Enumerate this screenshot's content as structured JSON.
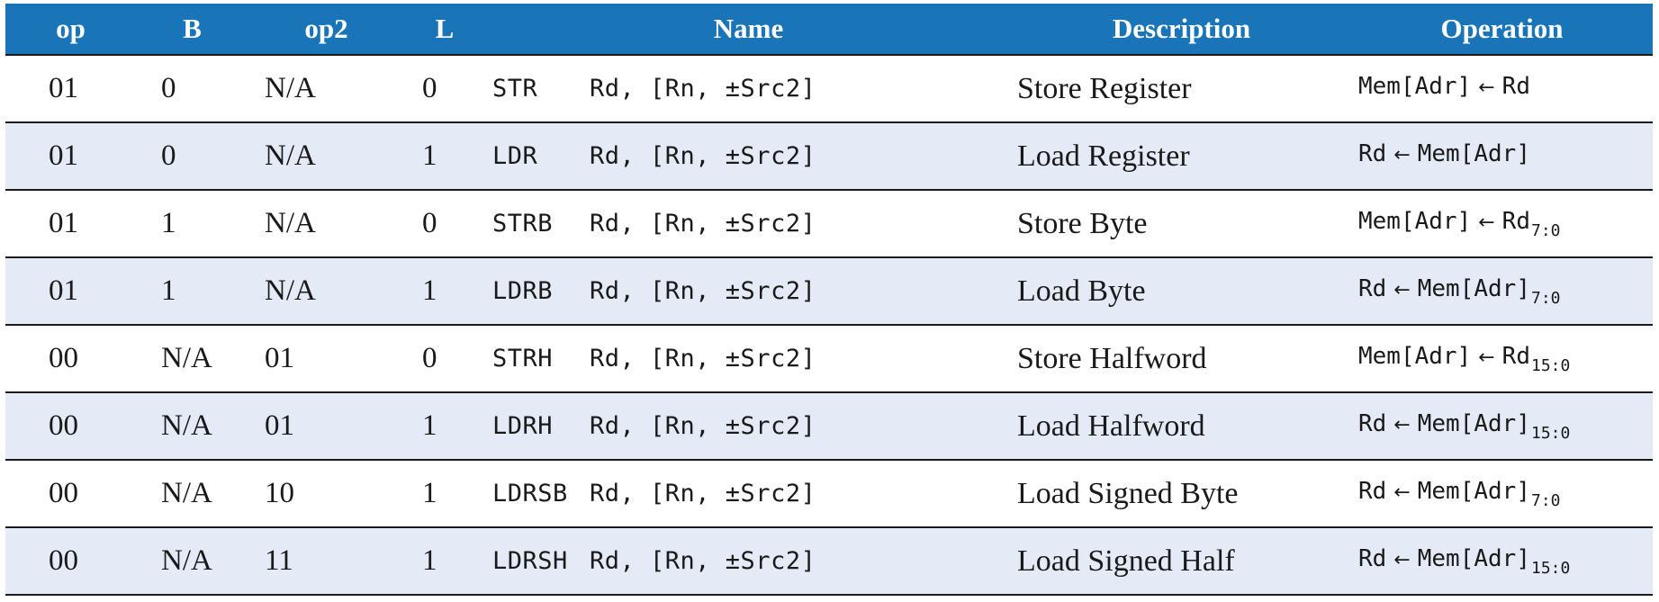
{
  "table": {
    "headers": [
      "op",
      "B",
      "op2",
      "L",
      "Name",
      "Description",
      "Operation"
    ],
    "rows": [
      {
        "op": "01",
        "b": "0",
        "op2": "N/A",
        "l": "0",
        "mnemonic": "STR",
        "operands": "Rd, [Rn, ±Src2]",
        "description": "Store Register",
        "oper_left": "Mem[Adr]",
        "arrow": "←",
        "oper_right": "Rd",
        "oper_sub": ""
      },
      {
        "op": "01",
        "b": "0",
        "op2": "N/A",
        "l": "1",
        "mnemonic": "LDR",
        "operands": "Rd, [Rn, ±Src2]",
        "description": "Load Register",
        "oper_left": "Rd",
        "arrow": "←",
        "oper_right": "Mem[Adr]",
        "oper_sub": ""
      },
      {
        "op": "01",
        "b": "1",
        "op2": "N/A",
        "l": "0",
        "mnemonic": "STRB",
        "operands": "Rd, [Rn, ±Src2]",
        "description": "Store Byte",
        "oper_left": "Mem[Adr]",
        "arrow": "←",
        "oper_right": "Rd",
        "oper_sub": "7:0"
      },
      {
        "op": "01",
        "b": "1",
        "op2": "N/A",
        "l": "1",
        "mnemonic": "LDRB",
        "operands": "Rd, [Rn, ±Src2]",
        "description": "Load Byte",
        "oper_left": "Rd",
        "arrow": "←",
        "oper_right": "Mem[Adr]",
        "oper_sub": "7:0"
      },
      {
        "op": "00",
        "b": "N/A",
        "op2": "01",
        "l": "0",
        "mnemonic": "STRH",
        "operands": "Rd, [Rn, ±Src2]",
        "description": "Store Halfword",
        "oper_left": "Mem[Adr]",
        "arrow": "←",
        "oper_right": "Rd",
        "oper_sub": "15:0"
      },
      {
        "op": "00",
        "b": "N/A",
        "op2": "01",
        "l": "1",
        "mnemonic": "LDRH",
        "operands": "Rd, [Rn, ±Src2]",
        "description": "Load Halfword",
        "oper_left": "Rd",
        "arrow": "←",
        "oper_right": "Mem[Adr]",
        "oper_sub": "15:0"
      },
      {
        "op": "00",
        "b": "N/A",
        "op2": "10",
        "l": "1",
        "mnemonic": "LDRSB",
        "operands": "Rd, [Rn, ±Src2]",
        "description": "Load Signed Byte",
        "oper_left": "Rd",
        "arrow": "←",
        "oper_right": "Mem[Adr]",
        "oper_sub": "7:0"
      },
      {
        "op": "00",
        "b": "N/A",
        "op2": "11",
        "l": "1",
        "mnemonic": "LDRSH",
        "operands": "Rd, [Rn, ±Src2]",
        "description": "Load Signed Half",
        "oper_left": "Rd",
        "arrow": "←",
        "oper_right": "Mem[Adr]",
        "oper_sub": "15:0"
      }
    ]
  },
  "colors": {
    "header_bg": "#1a74b8",
    "header_text": "#ffffff",
    "row_alt_bg": "#e4ebf6",
    "rule": "#1a1a1a"
  }
}
